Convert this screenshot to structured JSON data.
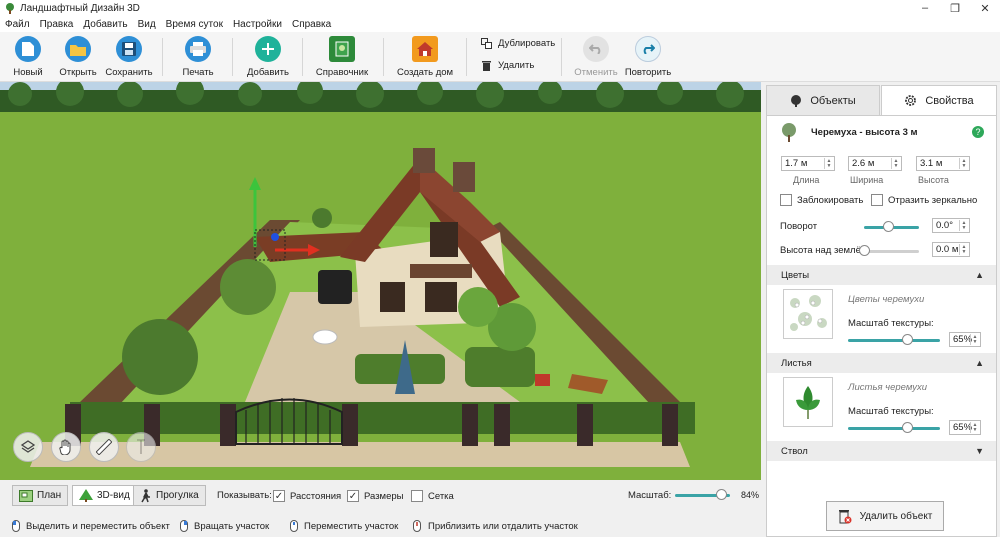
{
  "window": {
    "title": "Ландшафтный Дизайн 3D",
    "controls": [
      "–",
      "❐",
      "✕"
    ]
  },
  "menu": [
    "Файл",
    "Правка",
    "Добавить",
    "Вид",
    "Время суток",
    "Настройки",
    "Справка"
  ],
  "toolbar": {
    "new": "Новый",
    "open": "Открыть",
    "save": "Сохранить",
    "print": "Печать",
    "add": "Добавить",
    "reference": "Справочник",
    "create_house": "Создать дом",
    "duplicate": "Дублировать",
    "delete": "Удалить",
    "undo": "Отменить",
    "redo": "Повторить"
  },
  "views": {
    "plan": "План",
    "view3d": "3D-вид",
    "walk": "Прогулка"
  },
  "show": {
    "label": "Показывать:",
    "distances": {
      "label": "Расстояния",
      "checked": true
    },
    "sizes": {
      "label": "Размеры",
      "checked": true
    },
    "grid": {
      "label": "Сетка",
      "checked": false
    }
  },
  "scale": {
    "label": "Масштаб:",
    "value": "84%",
    "fraction": 0.84
  },
  "status": {
    "select_move": "Выделить и переместить объект",
    "rotate": "Вращать участок",
    "move": "Переместить участок",
    "zoom": "Приблизить или отдалить участок"
  },
  "panel": {
    "tab_objects": "Объекты",
    "tab_properties": "Свойства",
    "object_name": "Черемуха - высота 3 м",
    "length": {
      "value": "1.7 м",
      "label": "Длина"
    },
    "width": {
      "value": "2.6 м",
      "label": "Ширина"
    },
    "height": {
      "value": "3.1 м",
      "label": "Высота"
    },
    "lock": "Заблокировать",
    "mirror": "Отразить зеркально",
    "rotation": {
      "label": "Поворот",
      "value": "0.0°",
      "fraction": 0.45
    },
    "elevation": {
      "label": "Высота над землёй",
      "value": "0.0 м",
      "fraction": 0.0
    },
    "flowers": {
      "title": "Цветы",
      "name": "Цветы черемухи",
      "scale_label": "Масштаб текстуры:",
      "scale_value": "65%",
      "fraction": 0.65
    },
    "leaves": {
      "title": "Листья",
      "name": "Листья черемухи",
      "scale_label": "Масштаб текстуры:",
      "scale_value": "65%",
      "fraction": 0.65
    },
    "trunk": {
      "title": "Ствол"
    },
    "delete_object": "Удалить объект"
  }
}
